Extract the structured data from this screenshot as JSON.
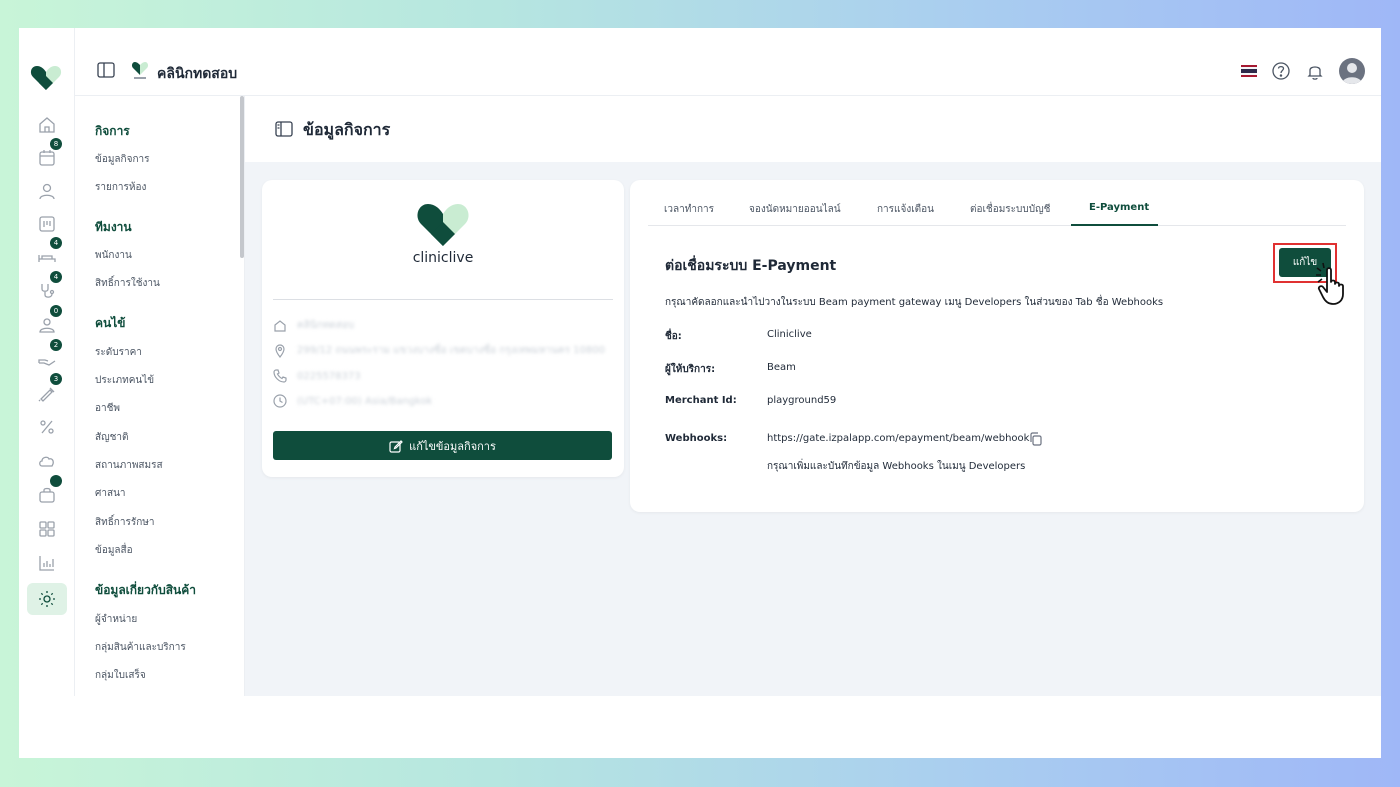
{
  "topbar": {
    "clinic_name": "คลินิกทดสอบ"
  },
  "rail": {
    "icons": [
      {
        "name": "home-icon"
      },
      {
        "name": "calendar-icon",
        "badge": "8"
      },
      {
        "name": "user-icon"
      },
      {
        "name": "board-icon"
      },
      {
        "name": "bed-icon",
        "badge": "4"
      },
      {
        "name": "stethoscope-icon",
        "badge": "4"
      },
      {
        "name": "patient-icon",
        "badge": "0"
      },
      {
        "name": "hand-icon",
        "badge": "2"
      },
      {
        "name": "syringe-icon",
        "badge": "3"
      },
      {
        "name": "percent-icon"
      },
      {
        "name": "cloud-icon"
      },
      {
        "name": "bag-icon"
      },
      {
        "name": "grid-icon"
      },
      {
        "name": "chart-icon"
      },
      {
        "name": "gear-icon"
      }
    ],
    "bag_dot_color": "#0f4d3c"
  },
  "menu": {
    "sections": [
      {
        "title": "กิจการ",
        "items": [
          "ข้อมูลกิจการ",
          "รายการห้อง"
        ]
      },
      {
        "title": "ทีมงาน",
        "items": [
          "พนักงาน",
          "สิทธิ์การใช้งาน"
        ]
      },
      {
        "title": "คนไข้",
        "items": [
          "ระดับราคา",
          "ประเภทคนไข้",
          "อาชีพ",
          "สัญชาติ",
          "สถานภาพสมรส",
          "ศาสนา",
          "สิทธิ์การรักษา",
          "ข้อมูลสื่อ"
        ]
      },
      {
        "title": "ข้อมูลเกี่ยวกับสินค้า",
        "items": [
          "ผู้จำหน่าย",
          "กลุ่มสินค้าและบริการ",
          "กลุ่มใบเสร็จ"
        ]
      }
    ]
  },
  "page": {
    "title": "ข้อมูลกิจการ"
  },
  "business_card": {
    "logo_text": "cliniclive",
    "blurred": {
      "name": "คลินิกทดสอบ",
      "address": "299/12 ถนนพระราม แขวงบางซื่อ เขตบางซื่อ กรุงเทพมหานคร 10800",
      "phone": "0225578373",
      "timezone": "(UTC+07:00) Asia/Bangkok"
    },
    "edit_button": "แก้ไขข้อมูลกิจการ"
  },
  "settings": {
    "tabs": [
      "เวลาทำการ",
      "จองนัดหมายออนไลน์",
      "การแจ้งเตือน",
      "ต่อเชื่อมระบบบัญชี",
      "E-Payment"
    ],
    "active_tab": "E-Payment",
    "section_title": "ต่อเชื่อมระบบ E-Payment",
    "edit_button": "แก้ไข",
    "instruction": "กรุณาคัดลอกและนำไปวางในระบบ Beam payment gateway เมนู Developers ในส่วนของ Tab ชื่อ Webhooks",
    "fields": {
      "name_label": "ชื่อ:",
      "name_value": "Cliniclive",
      "provider_label": "ผู้ให้บริการ:",
      "provider_value": "Beam",
      "merchant_label": "Merchant Id:",
      "merchant_value": "playground59",
      "webhooks_label": "Webhooks:",
      "webhooks_value": "https://gate.izpalapp.com/epayment/beam/webhook",
      "webhooks_hint": "กรุณาเพิ่มและบันทึกข้อมูล Webhooks ในเมนู Developers"
    }
  },
  "colors": {
    "brand": "#0f4d3c",
    "highlight": "#e03131"
  }
}
